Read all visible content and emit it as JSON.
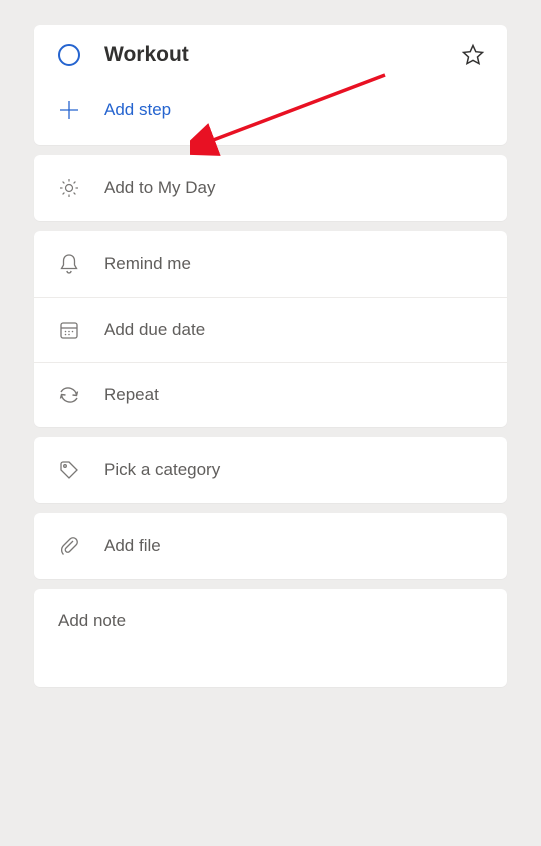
{
  "task": {
    "title": "Workout",
    "add_step_label": "Add step"
  },
  "options": {
    "my_day": "Add to My Day",
    "remind": "Remind me",
    "due_date": "Add due date",
    "repeat": "Repeat",
    "category": "Pick a category",
    "file": "Add file",
    "note": "Add note"
  },
  "annotation": {
    "arrow_target": "add-step"
  }
}
